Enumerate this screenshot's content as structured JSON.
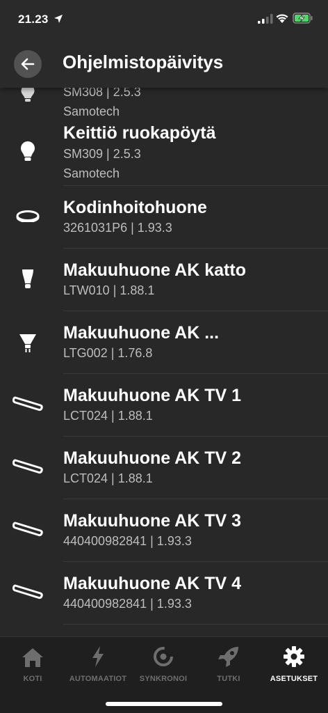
{
  "status": {
    "time": "21.23"
  },
  "header": {
    "title": "Ohjelmistopäivitys"
  },
  "devices": [
    {
      "name": "",
      "model": "SM308 | 2.5.3",
      "maker": "Samotech",
      "icon": "bulb-icon"
    },
    {
      "name": "Keittiö ruokapöytä",
      "model": "SM309 | 2.5.3",
      "maker": "Samotech",
      "icon": "bulb-icon"
    },
    {
      "name": "Kodinhoitohuone",
      "model": "3261031P6 | 1.93.3",
      "icon": "ceiling-ring-icon"
    },
    {
      "name": "Makuuhuone AK katto",
      "model": "LTW010 | 1.88.1",
      "icon": "bulb-icon"
    },
    {
      "name": "Makuuhuone AK ...",
      "model": "LTG002 | 1.76.8",
      "icon": "spot-bulb-icon"
    },
    {
      "name": "Makuuhuone AK TV 1",
      "model": "LCT024 | 1.88.1",
      "icon": "light-bar-icon"
    },
    {
      "name": "Makuuhuone AK TV 2",
      "model": "LCT024 | 1.88.1",
      "icon": "light-bar-icon"
    },
    {
      "name": "Makuuhuone AK TV 3",
      "model": "440400982841 | 1.93.3",
      "icon": "light-bar-icon"
    },
    {
      "name": "Makuuhuone AK TV 4",
      "model": "440400982841 | 1.93.3",
      "icon": "light-bar-icon"
    }
  ],
  "tabs": [
    {
      "label": "KOTI",
      "icon": "home-icon",
      "active": false
    },
    {
      "label": "AUTOMAATIOT",
      "icon": "lightning-icon",
      "active": false
    },
    {
      "label": "SYNKRONOI",
      "icon": "sync-icon",
      "active": false
    },
    {
      "label": "TUTKI",
      "icon": "rocket-icon",
      "active": false
    },
    {
      "label": "ASETUKSET",
      "icon": "gear-icon",
      "active": true
    }
  ]
}
